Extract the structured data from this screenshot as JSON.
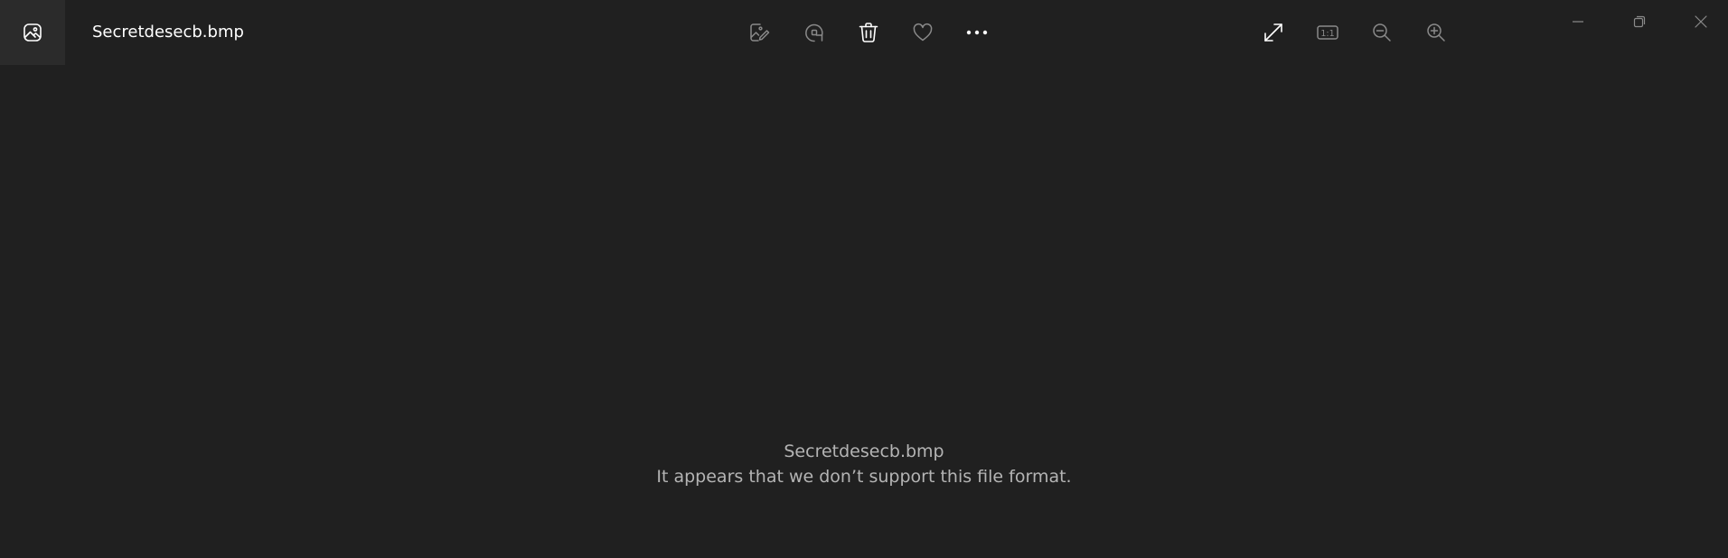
{
  "window": {
    "title": "Secretdesecb.bmp"
  },
  "toolbar": {
    "left_actions": [
      {
        "name": "edit-image-icon",
        "tooltip": "Edit image"
      },
      {
        "name": "rotate-icon",
        "tooltip": "Rotate"
      },
      {
        "name": "delete-icon",
        "tooltip": "Delete"
      },
      {
        "name": "heart-icon",
        "tooltip": "Add to favorites"
      },
      {
        "name": "more-icon",
        "tooltip": "See more"
      }
    ],
    "right_actions": [
      {
        "name": "fullscreen-icon",
        "tooltip": "Full screen"
      },
      {
        "name": "actual-size-icon",
        "label": "1:1"
      },
      {
        "name": "zoom-out-icon",
        "tooltip": "Zoom out"
      },
      {
        "name": "zoom-in-icon",
        "tooltip": "Zoom in"
      }
    ]
  },
  "window_controls": {
    "minimize": "minimize-icon",
    "restore": "restore-icon",
    "close": "close-icon"
  },
  "content": {
    "file_name": "Secretdesecb.bmp",
    "error_message": "It appears that we don’t support this file format."
  },
  "colors": {
    "background": "#202020",
    "title_text": "#ffffff",
    "icon_enabled": "#ffffff",
    "icon_disabled": "#8a8a8a",
    "message_text": "#b4b4b4"
  }
}
